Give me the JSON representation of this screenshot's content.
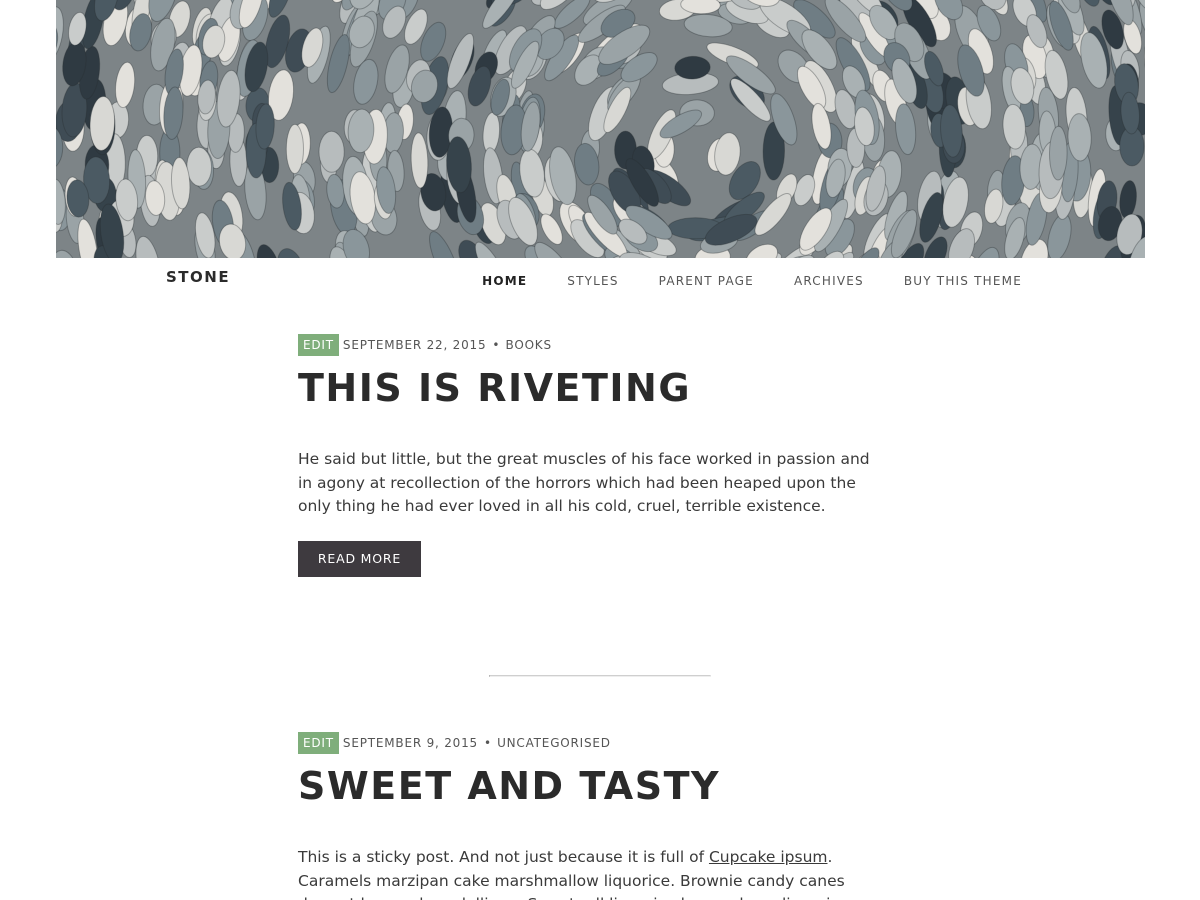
{
  "site": {
    "title": "STONE"
  },
  "nav": {
    "items": [
      {
        "label": "HOME",
        "current": true
      },
      {
        "label": "STYLES",
        "current": false
      },
      {
        "label": "PARENT PAGE",
        "current": false
      },
      {
        "label": "ARCHIVES",
        "current": false
      },
      {
        "label": "BUY THIS THEME",
        "current": false
      }
    ]
  },
  "posts": [
    {
      "edit_label": "EDIT",
      "date": "SEPTEMBER 22, 2015",
      "separator": "•",
      "category": "BOOKS",
      "title": "THIS IS RIVETING",
      "excerpt": "He said but little, but the great muscles of his face worked in passion and in agony at recollection of the horrors which had been heaped upon the only thing he had ever loved in all his cold, cruel, terrible existence.",
      "read_more": "READ MORE"
    },
    {
      "edit_label": "EDIT",
      "date": "SEPTEMBER 9, 2015",
      "separator": "•",
      "category": "UNCATEGORISED",
      "title": "SWEET AND TASTY",
      "excerpt_before": "This is a sticky post. And not just because it is full of ",
      "excerpt_link": "Cupcake ipsum",
      "excerpt_after": ". Caramels marzipan cake marshmallow liquorice. Brownie candy canes dessert lemon drops lollipop. Sweet roll liquorice lemon drops liquorice apple pie bonbon topping. Sugar"
    }
  ],
  "colors": {
    "edit_badge": "#7fae7b",
    "read_more_bg": "#3e3a3f",
    "text": "#2b2b2b"
  }
}
